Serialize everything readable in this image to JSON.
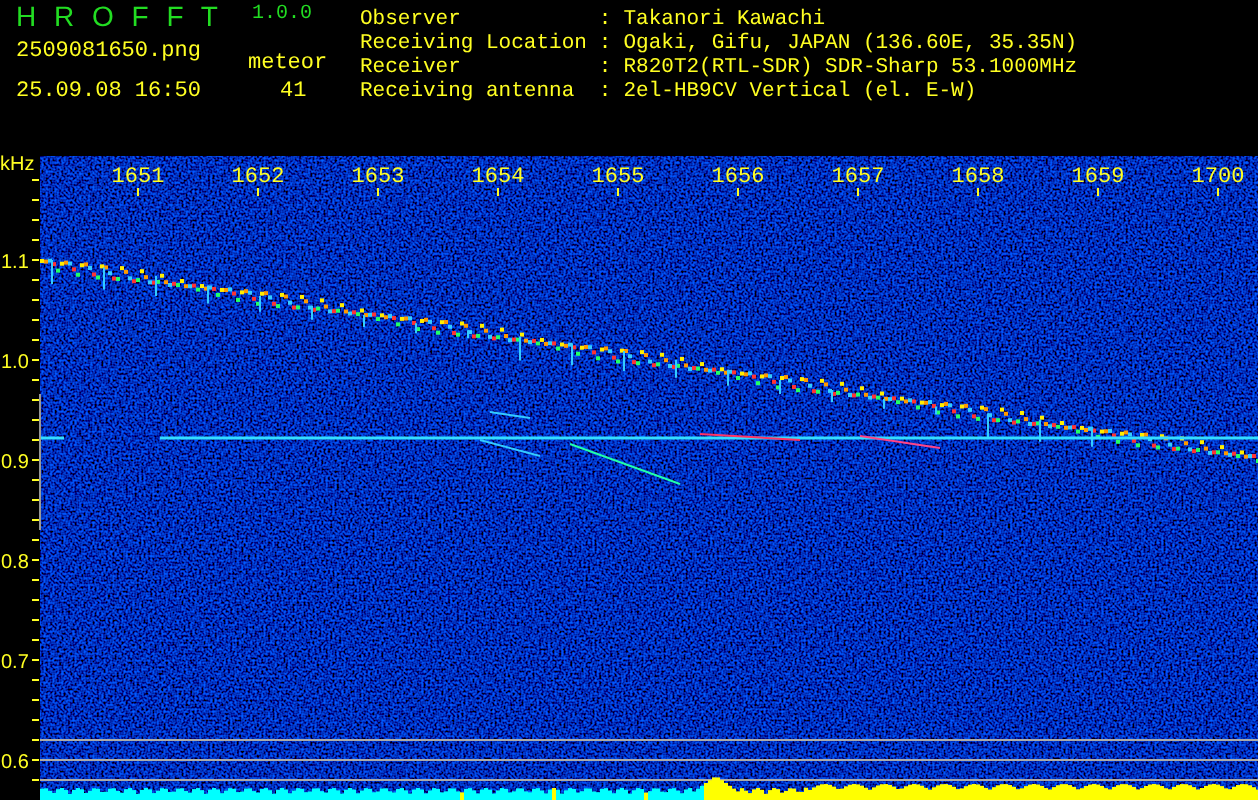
{
  "header": {
    "title": "H R O F F T",
    "version": "1.0.0",
    "filename": "2509081650.png",
    "datetime": "25.09.08 16:50",
    "count_label": "meteor",
    "count": "41"
  },
  "info": [
    {
      "label": "Observer",
      "sep": ":",
      "value": "Takanori Kawachi"
    },
    {
      "label": "Receiving Location",
      "sep": ":",
      "value": "Ogaki, Gifu, JAPAN (136.60E, 35.35N)"
    },
    {
      "label": "Receiver",
      "sep": ":",
      "value": "R820T2(RTL-SDR) SDR-Sharp 53.1000MHz"
    },
    {
      "label": "Receiving antenna",
      "sep": ":",
      "value": "2el-HB9CV Vertical (el. E-W)"
    }
  ],
  "spectrogram": {
    "y_unit": "kHz",
    "x_labels": [
      "1651",
      "1652",
      "1653",
      "1654",
      "1655",
      "1656",
      "1657",
      "1658",
      "1659",
      "1700"
    ],
    "y_labels": [
      "1.1",
      "1.0",
      "0.9",
      "0.8",
      "0.7",
      "0.6"
    ]
  }
}
